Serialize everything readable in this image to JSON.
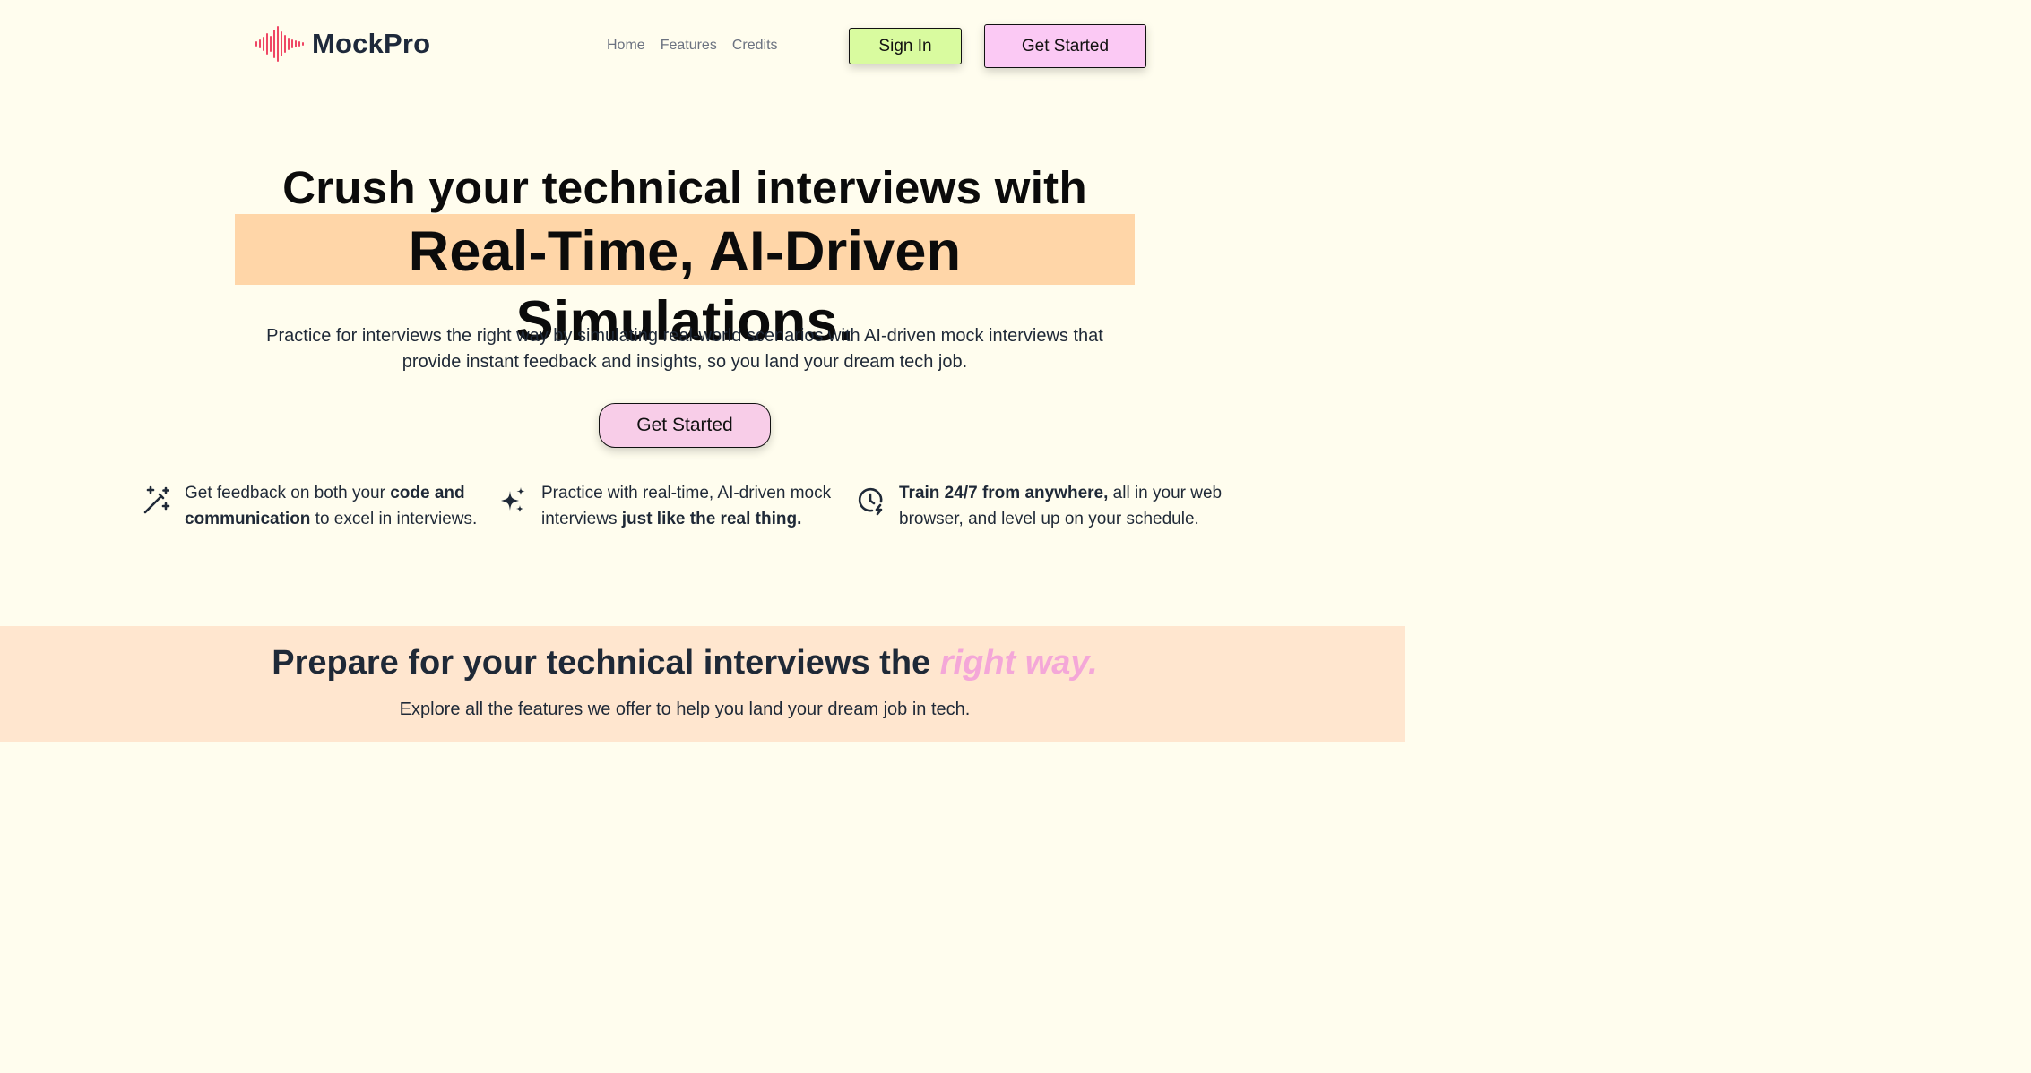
{
  "brand": {
    "name": "MockPro",
    "logo_icon": "sound-wave-icon",
    "accent": "#ef4765"
  },
  "nav": {
    "links": [
      "Home",
      "Features",
      "Credits"
    ],
    "sign_in": "Sign In",
    "get_started": "Get Started"
  },
  "hero": {
    "title_line1": "Crush your technical interviews with",
    "title_line2": "Real-Time, AI-Driven Simulations.",
    "subtitle": "Practice for interviews the right way by simulating real-world scenarios with AI-driven mock interviews that provide instant feedback and insights, so you land your dream tech job.",
    "cta": "Get Started",
    "highlight_color": "#ffd6a8"
  },
  "features": [
    {
      "icon": "magic-wand-icon",
      "t1": "Get feedback on both your ",
      "b1": "code and communication",
      "t2": " to excel in interviews."
    },
    {
      "icon": "sparkles-icon",
      "t1": "Practice with real-time, AI-driven mock interviews ",
      "b1": "just like the real thing.",
      "t2": ""
    },
    {
      "icon": "clock-bolt-icon",
      "b1": "Train 24/7 from anywhere,",
      "t2": " all in your web browser, and level up on your schedule."
    }
  ],
  "section2": {
    "title_prefix": "Prepare for your technical interviews the ",
    "title_accent": "right way.",
    "subtitle": "Explore all the features we offer to help you land your dream job in tech.",
    "background": "#ffe6cf",
    "accent_color": "#f4a7d8"
  },
  "colors": {
    "page_background": "#fffdee",
    "sign_in_button": "#d9fb9f",
    "get_started_button": "#fbc9f4"
  }
}
